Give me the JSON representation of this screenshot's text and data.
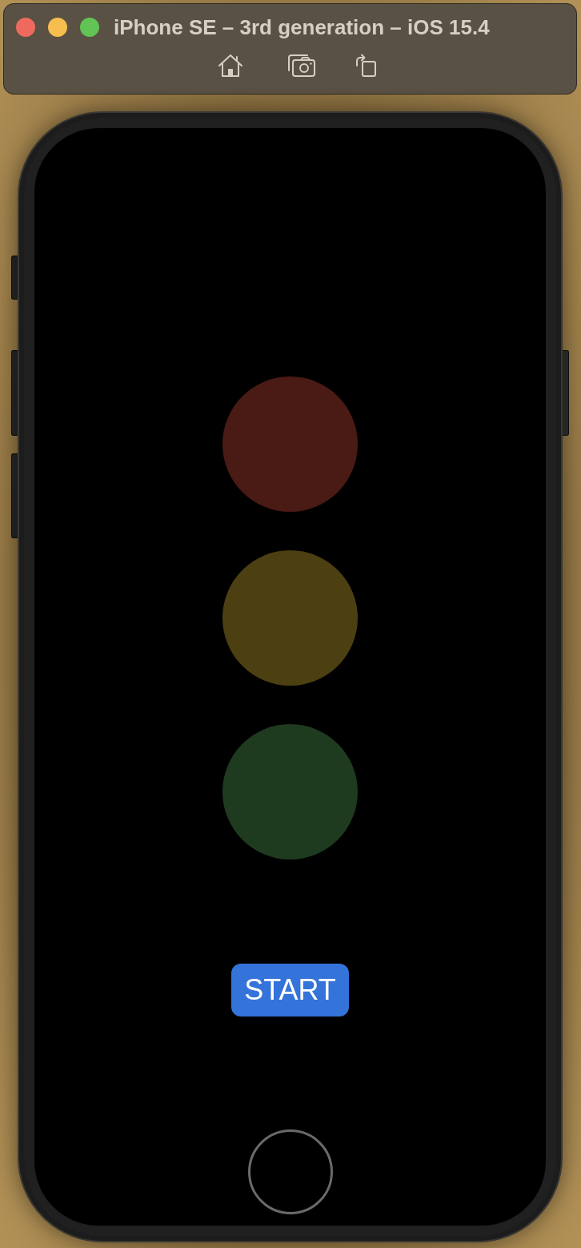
{
  "window": {
    "title": "iPhone SE – 3rd generation – iOS 15.4",
    "controls": [
      {
        "color": "#ee6a5f"
      },
      {
        "color": "#f5be4f"
      },
      {
        "color": "#61c454"
      }
    ],
    "toolbar": [
      {
        "kind": "home"
      },
      {
        "kind": "screenshot"
      },
      {
        "kind": "rotate"
      }
    ]
  },
  "screen": {
    "lights": [
      {
        "color": "#4a1a14"
      },
      {
        "color": "#4c3f12"
      },
      {
        "color": "#1e3b20"
      }
    ],
    "button": {
      "label": "START"
    }
  }
}
